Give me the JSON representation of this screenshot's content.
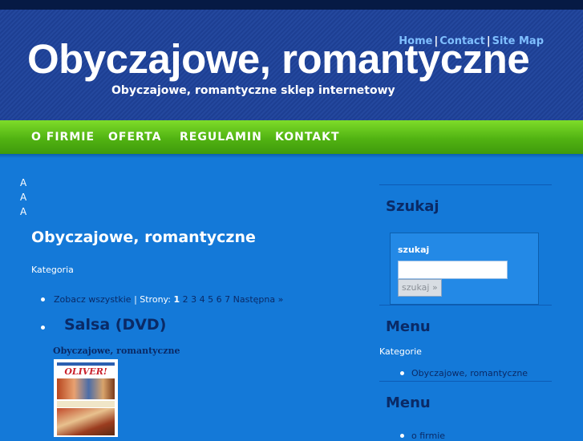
{
  "header": {
    "top_links": [
      "Home",
      "Contact",
      "Site Map"
    ],
    "separator": "|",
    "site_title": "Obyczajowe, romantyczne",
    "site_tagline": "Obyczajowe, romantyczne sklep internetowy"
  },
  "nav": {
    "items": [
      "O FIRMIE",
      "OFERTA",
      "REGULAMIN",
      "KONTAKT"
    ]
  },
  "main": {
    "stray_letters": [
      "A",
      "A",
      "A"
    ],
    "page_title": "Obyczajowe, romantyczne",
    "category_label": "Kategoria",
    "pagination": {
      "see_all": "Zobacz wszystkie",
      "pages_label": "| Strony:",
      "current": "1",
      "pages": [
        "2",
        "3",
        "4",
        "5",
        "6",
        "7"
      ],
      "next": "Następna »"
    },
    "product": {
      "title": "Salsa (DVD)",
      "category": "Obyczajowe, romantyczne",
      "cover_text": "OLIVER!"
    }
  },
  "sidebar": {
    "search": {
      "heading": "Szukaj",
      "label": "szukaj",
      "input_value": "",
      "button_label": "szukaj »"
    },
    "menu1": {
      "heading": "Menu",
      "label": "Kategorie",
      "items": [
        "Obyczajowe, romantyczne"
      ]
    },
    "menu2": {
      "heading": "Menu",
      "items": [
        "o firmie"
      ]
    }
  },
  "colors": {
    "background": "#1479d8",
    "header": "#1d3f93",
    "nav_green": "#51b312",
    "dark_text": "#0a2a66",
    "top_link": "#7fbfff"
  }
}
